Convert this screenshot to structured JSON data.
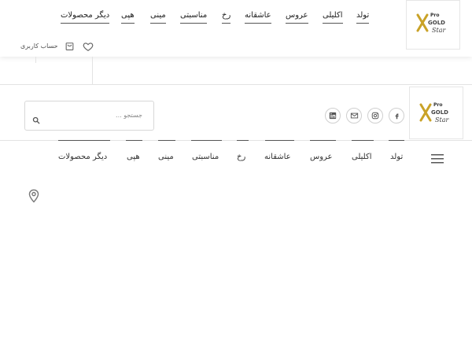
{
  "brand": {
    "logo_top": "Pro",
    "logo_mid": "GOLD",
    "logo_script": "Star"
  },
  "top_nav": [
    {
      "label": "تولد"
    },
    {
      "label": "اکلیلی"
    },
    {
      "label": "عروس"
    },
    {
      "label": "عاشقانه"
    },
    {
      "label": "رخ"
    },
    {
      "label": "مناسبتی"
    },
    {
      "label": "مینی"
    },
    {
      "label": "هپی"
    },
    {
      "label": "دیگر محصولات"
    }
  ],
  "account": {
    "label": "حساب کاربری"
  },
  "search": {
    "placeholder": "جستجو ..."
  },
  "social": [
    {
      "icon": "facebook-icon"
    },
    {
      "icon": "instagram-icon"
    },
    {
      "icon": "mail-icon"
    },
    {
      "icon": "linkedin-icon"
    }
  ],
  "bottom_nav": [
    {
      "label": "تولد"
    },
    {
      "label": "اکلیلی"
    },
    {
      "label": "عروس"
    },
    {
      "label": "عاشقانه"
    },
    {
      "label": "رخ"
    },
    {
      "label": "مناسبتی"
    },
    {
      "label": "مینی"
    },
    {
      "label": "هپی"
    },
    {
      "label": "دیگر محصولات"
    }
  ],
  "colors": {
    "gold": "#c9a227",
    "text": "#222222",
    "border": "#e3e3e3"
  }
}
